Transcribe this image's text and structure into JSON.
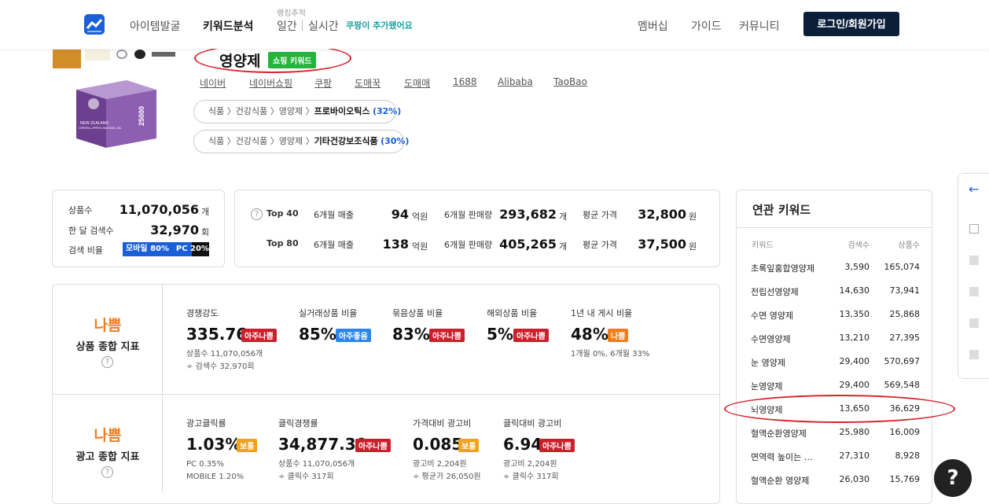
{
  "nav": {
    "items": [
      "아이템발굴",
      "키워드분석"
    ],
    "ranking_label": "랭킹추적",
    "ranking_items": [
      "일간",
      "실시간"
    ],
    "coupang_note": "쿠팡이 추가됐어요",
    "right_items": [
      "멤버십",
      "가이드",
      "커뮤니티"
    ],
    "login": "로그인/회원가입"
  },
  "keyword": {
    "title": "영양제",
    "badge": "쇼핑 키워드",
    "links": [
      "네이버",
      "네이버쇼핑",
      "쿠팡",
      "도매꾹",
      "도매매",
      "1688",
      "Alibaba",
      "TaoBao"
    ],
    "categories": [
      {
        "path": [
          "식품",
          "건강식품",
          "영양제"
        ],
        "leaf": "프로바이오틱스",
        "pct": "(32%)"
      },
      {
        "path": [
          "식품",
          "건강식품",
          "영양제"
        ],
        "leaf": "기타건강보조식품",
        "pct": "(30%)"
      }
    ],
    "product_text": [
      "NEW ZEALAND",
      "GREEN-LIPPED MUSSEL OIL",
      "25000"
    ]
  },
  "summary": {
    "product_count_label": "상품수",
    "product_count": "11,070,056",
    "product_count_unit": "개",
    "monthly_search_label": "한 달 검색수",
    "monthly_search": "32,970",
    "monthly_search_unit": "회",
    "search_ratio_label": "검색 비율",
    "mobile_label": "모바일 80%",
    "pc_label": "PC 20%",
    "mobile_pct": 80
  },
  "top": {
    "q": "?",
    "rows": [
      {
        "name": "Top 40",
        "sales_label": "6개월 매출",
        "sales": "94",
        "sales_unit": "억원",
        "qty_label": "6개월 판매량",
        "qty": "293,682",
        "qty_unit": "개",
        "price_label": "평균 가격",
        "price": "32,800",
        "price_unit": "원"
      },
      {
        "name": "Top 80",
        "sales_label": "6개월 매출",
        "sales": "138",
        "sales_unit": "억원",
        "qty_label": "6개월 판매량",
        "qty": "405,265",
        "qty_unit": "개",
        "price_label": "평균 가격",
        "price": "37,500",
        "price_unit": "원"
      }
    ]
  },
  "product_index": {
    "grade": "나쁨",
    "label": "상품 종합 지표",
    "help": "?",
    "metrics": [
      {
        "label": "경쟁강도",
        "value": "335.76",
        "tag": "아주나쁨",
        "sub": [
          "상품수 11,070,056개",
          "÷ 검색수 32,970회"
        ]
      },
      {
        "label": "실거래상품 비율",
        "value": "85%",
        "tag": "아주좋음",
        "sub": []
      },
      {
        "label": "묶음상품 비율",
        "value": "83%",
        "tag": "아주나쁨",
        "sub": []
      },
      {
        "label": "해외상품 비율",
        "value": "5%",
        "tag": "아주나쁨",
        "sub": []
      },
      {
        "label": "1년 내 게시 비율",
        "value": "48%",
        "tag": "나쁨",
        "sub": [
          "1개월 0%, 6개월 33%"
        ]
      }
    ]
  },
  "ad_index": {
    "grade": "나쁨",
    "label": "광고 종합 지표",
    "help": "?",
    "metrics": [
      {
        "label": "광고클릭률",
        "value": "1.03%",
        "tag": "보통",
        "sub": [
          "PC 0.35%",
          "MOBILE 1.20%"
        ]
      },
      {
        "label": "클릭경쟁률",
        "value": "34,877.30",
        "tag": "아주나쁨",
        "sub": [
          "상품수 11,070,056개",
          "÷ 클릭수 317회"
        ]
      },
      {
        "label": "가격대비 광고비",
        "value": "0.085",
        "tag": "보통",
        "sub": [
          "광고비 2,204원",
          "÷ 평균가 26,050원"
        ]
      },
      {
        "label": "클릭대비 광고비",
        "value": "6.94",
        "tag": "아주나쁨",
        "sub": [
          "광고비 2,204원",
          "÷ 클릭수 317회"
        ]
      }
    ]
  },
  "related": {
    "title": "연관 키워드",
    "headers": [
      "키워드",
      "검색수",
      "상품수"
    ],
    "rows": [
      [
        "초록잎홍합영양제",
        "3,590",
        "165,074"
      ],
      [
        "전립선영양제",
        "14,630",
        "73,941"
      ],
      [
        "수면 영양제",
        "13,350",
        "25,868"
      ],
      [
        "수면영양제",
        "13,210",
        "27,395"
      ],
      [
        "눈 영양제",
        "29,400",
        "570,697"
      ],
      [
        "눈영양제",
        "29,400",
        "569,548"
      ],
      [
        "뇌영양제",
        "13,650",
        "36,629"
      ],
      [
        "혈액순환영양제",
        "25,980",
        "16,009"
      ],
      [
        "면역력 높이는 …",
        "27,310",
        "8,928"
      ],
      [
        "혈액순환 영양제",
        "26,030",
        "15,769"
      ]
    ]
  },
  "side": {
    "back": "←"
  },
  "help": "?",
  "colors": {
    "brand": "#1a5fd8",
    "login_bg": "#0b1f3a",
    "badge_green": "#25b53c",
    "grade_orange": "#f07d1c",
    "tag_red": "#c9202a",
    "tag_blue": "#2a86e8",
    "tag_orange": "#f2a21a",
    "annotation_red": "#d9222a"
  }
}
